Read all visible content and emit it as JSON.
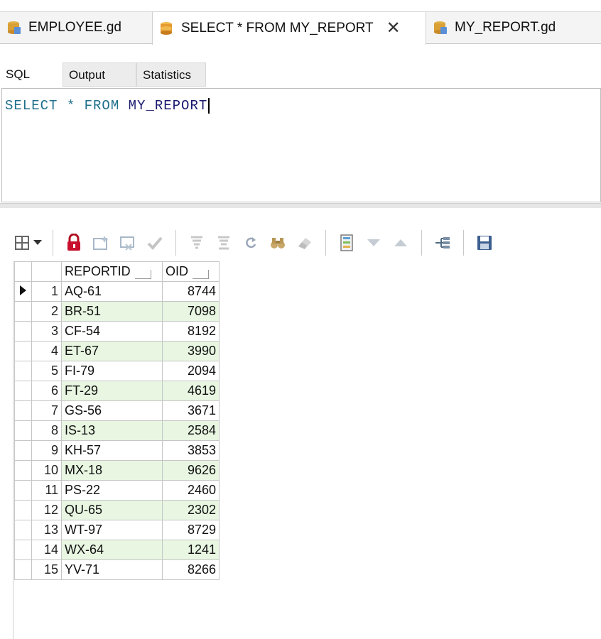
{
  "tabs": [
    {
      "label": "EMPLOYEE.gd",
      "icon": "database-table-icon",
      "active": false
    },
    {
      "label": "SELECT * FROM MY_REPORT",
      "icon": "sql-query-icon",
      "active": true,
      "close": "✕"
    },
    {
      "label": "MY_REPORT.gd",
      "icon": "database-table-icon",
      "active": false
    }
  ],
  "subtabs": [
    "SQL",
    "Output",
    "Statistics"
  ],
  "editor": {
    "keywords": "SELECT * FROM ",
    "table": "MY_REPORT"
  },
  "toolbar": {
    "icons": [
      "grid-menu-icon",
      "dropdown-arrow-icon",
      "lock-icon",
      "insert-record-icon",
      "delete-record-icon",
      "post-edit-icon",
      "filter-icon",
      "filter-clear-icon",
      "refresh-icon",
      "find-icon",
      "eraser-icon",
      "form-view-icon",
      "arrow-down-icon",
      "arrow-up-icon",
      "tree-view-icon",
      "save-icon"
    ]
  },
  "grid": {
    "columns": [
      "REPORTID",
      "OID"
    ],
    "rows": [
      {
        "n": "1",
        "reportid": "AQ-61",
        "oid": "8744"
      },
      {
        "n": "2",
        "reportid": "BR-51",
        "oid": "7098"
      },
      {
        "n": "3",
        "reportid": "CF-54",
        "oid": "8192"
      },
      {
        "n": "4",
        "reportid": "ET-67",
        "oid": "3990"
      },
      {
        "n": "5",
        "reportid": "FI-79",
        "oid": "2094"
      },
      {
        "n": "6",
        "reportid": "FT-29",
        "oid": "4619"
      },
      {
        "n": "7",
        "reportid": "GS-56",
        "oid": "3671"
      },
      {
        "n": "8",
        "reportid": "IS-13",
        "oid": "2584"
      },
      {
        "n": "9",
        "reportid": "KH-57",
        "oid": "3853"
      },
      {
        "n": "10",
        "reportid": "MX-18",
        "oid": "9626"
      },
      {
        "n": "11",
        "reportid": "PS-22",
        "oid": "2460"
      },
      {
        "n": "12",
        "reportid": "QU-65",
        "oid": "2302"
      },
      {
        "n": "13",
        "reportid": "WT-97",
        "oid": "8729"
      },
      {
        "n": "14",
        "reportid": "WX-64",
        "oid": "1241"
      },
      {
        "n": "15",
        "reportid": "YV-71",
        "oid": "8266"
      }
    ]
  },
  "colors": {
    "alt_row": "#e8f6e2",
    "sql_text": "#1f6f8b",
    "table_name": "#1a1a6e"
  }
}
